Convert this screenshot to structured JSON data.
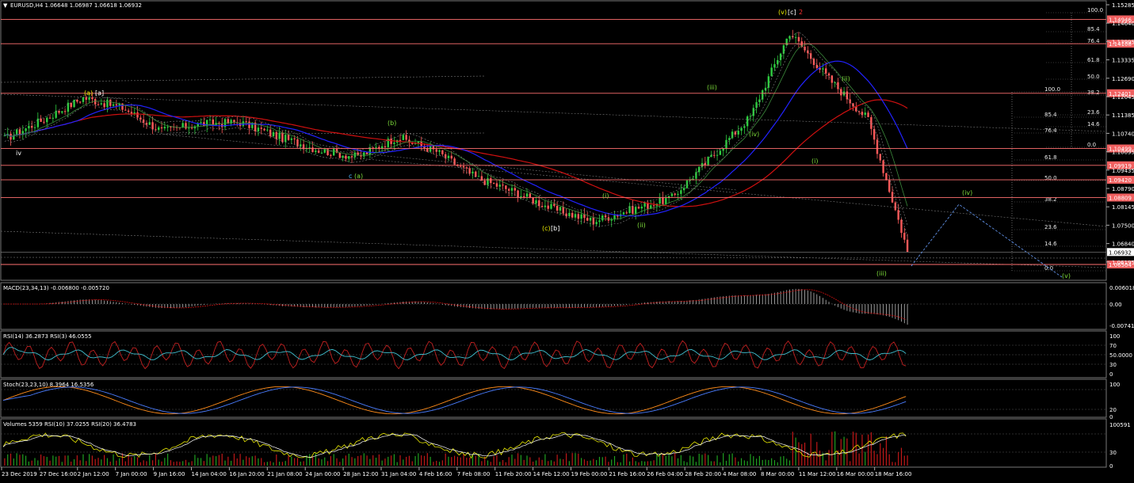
{
  "header": {
    "symbol_line": "EURUSD,H4  1.06648 1.06987 1.06618 1.06932"
  },
  "colors": {
    "background": "#000000",
    "bull_candle": "#2ecc40",
    "bear_candle": "#ff5a5a",
    "level_line": "#ff7070",
    "ma_blue": "#2222ff",
    "ma_red": "#d01010",
    "wave_green": "#7ddc3a",
    "wave_yellow": "#e8e800",
    "price_tag": "#f06060"
  },
  "price_axis": {
    "labels": [
      "1.15285",
      "1.14640",
      "1.13995",
      "1.13335",
      "1.12690",
      "1.12045",
      "1.11385",
      "1.10740",
      "1.10095",
      "1.09435",
      "1.08790",
      "1.08145",
      "1.07500",
      "1.06840",
      "1.06195"
    ],
    "tags": [
      {
        "price": "1.14946",
        "value": 1.14946
      },
      {
        "price": "1.14108",
        "value": 1.14108
      },
      {
        "price": "1.12401",
        "value": 1.12401
      },
      {
        "price": "1.10499",
        "value": 1.10499
      },
      {
        "price": "1.09919",
        "value": 1.09919
      },
      {
        "price": "1.09420",
        "value": 1.0942
      },
      {
        "price": "1.08809",
        "value": 1.08809
      },
      {
        "price": "1.06932",
        "value": 1.06932
      },
      {
        "price": "1.06504",
        "value": 1.06504
      }
    ]
  },
  "time_axis": {
    "labels": [
      "23 Dec 2019",
      "27 Dec 16:00",
      "2 Jan 12:00",
      "7 Jan 00:00",
      "9 Jan 16:00",
      "14 Jan 04:00",
      "16 Jan 20:00",
      "21 Jan 08:00",
      "24 Jan 00:00",
      "28 Jan 12:00",
      "31 Jan 04:00",
      "4 Feb 16:00",
      "7 Feb 08:00",
      "11 Feb 20:00",
      "14 Feb 12:00",
      "19 Feb 00:00",
      "21 Feb 16:00",
      "26 Feb 04:00",
      "28 Feb 20:00",
      "4 Mar 08:00",
      "8 Mar 00:00",
      "11 Mar 12:00",
      "16 Mar 00:00",
      "18 Mar 16:00"
    ]
  },
  "fib_right": {
    "levels": [
      "100.0",
      "85.4",
      "76.4",
      "61.8",
      "50.0",
      "38.2",
      "23.6",
      "14.6",
      "0.0"
    ]
  },
  "fib_left": {
    "levels": [
      "100.0",
      "85.4",
      "76.4",
      "61.8",
      "50.0",
      "38.2",
      "23.6",
      "14.6",
      "0.0"
    ]
  },
  "wave_labels": {
    "iv": "iv",
    "b_small": "(b)",
    "c_small_a": "c",
    "a_small": "(a)",
    "c_b": "(c)",
    "b_bracket": "[b]",
    "i_a": "(i)",
    "ii_a": "(ii)",
    "iii_a": "(iii)",
    "iv_a": "(iv)",
    "v_top": "(v)",
    "c_bracket": "[c]",
    "two_red": "2",
    "i_b": "(i)",
    "ii_b": "(ii)",
    "iii_b": "(iii)",
    "iv_b": "(iv)",
    "v_b": "(v)",
    "a_left": "(a)",
    "a_bracket": "[a]"
  },
  "panes": {
    "macd": {
      "header": "MACD(23,34,13) -0.006800 -0.005720",
      "axis": [
        "0.006018",
        "0.00",
        "-0.00741"
      ]
    },
    "rsi": {
      "header": "RSI(14) 36.2873  RSI(3) 46.0555",
      "axis": [
        "100",
        "70",
        "50.0000",
        "30",
        "0"
      ]
    },
    "stoch": {
      "header": "Stoch(23,23,10) 8.3964 16.5356",
      "axis": [
        "100",
        "20",
        "0"
      ]
    },
    "volumes": {
      "header": "Volumes 5359  RSI(10) 37.0255  RSI(20) 36.4783",
      "axis": [
        "100591",
        "30",
        "0"
      ]
    }
  },
  "chart_data": {
    "type": "candlestick",
    "symbol": "EURUSD",
    "timeframe": "H4",
    "last_bar": {
      "open": 1.06648,
      "high": 1.06987,
      "low": 1.06618,
      "close": 1.06932
    },
    "ylim": [
      1.0604,
      1.1545
    ],
    "anchor_prices": [
      {
        "date": "23 Dec 2019",
        "price": 1.1083
      },
      {
        "date": "27 Dec 16:00",
        "price": 1.115
      },
      {
        "date": "2 Jan 12:00",
        "price": 1.1225
      },
      {
        "date": "7 Jan 00:00",
        "price": 1.119
      },
      {
        "date": "9 Jan 16:00",
        "price": 1.111
      },
      {
        "date": "14 Jan 04:00",
        "price": 1.1135
      },
      {
        "date": "16 Jan 20:00",
        "price": 1.114
      },
      {
        "date": "21 Jan 08:00",
        "price": 1.109
      },
      {
        "date": "24 Jan 00:00",
        "price": 1.1045
      },
      {
        "date": "28 Jan 12:00",
        "price": 1.102
      },
      {
        "date": "31 Jan 04:00",
        "price": 1.109
      },
      {
        "date": "4 Feb 16:00",
        "price": 1.104
      },
      {
        "date": "7 Feb 08:00",
        "price": 1.095
      },
      {
        "date": "11 Feb 20:00",
        "price": 1.09
      },
      {
        "date": "14 Feb 12:00",
        "price": 1.084
      },
      {
        "date": "19 Feb 00:00",
        "price": 1.08
      },
      {
        "date": "21 Feb 16:00",
        "price": 1.084
      },
      {
        "date": "26 Feb 04:00",
        "price": 1.088
      },
      {
        "date": "28 Feb 20:00",
        "price": 1.102
      },
      {
        "date": "4 Mar 08:00",
        "price": 1.116
      },
      {
        "date": "8 Mar 00:00",
        "price": 1.145
      },
      {
        "date": "11 Mar 12:00",
        "price": 1.129
      },
      {
        "date": "16 Mar 00:00",
        "price": 1.115
      },
      {
        "date": "18 Mar 16:00",
        "price": 1.07
      }
    ]
  }
}
